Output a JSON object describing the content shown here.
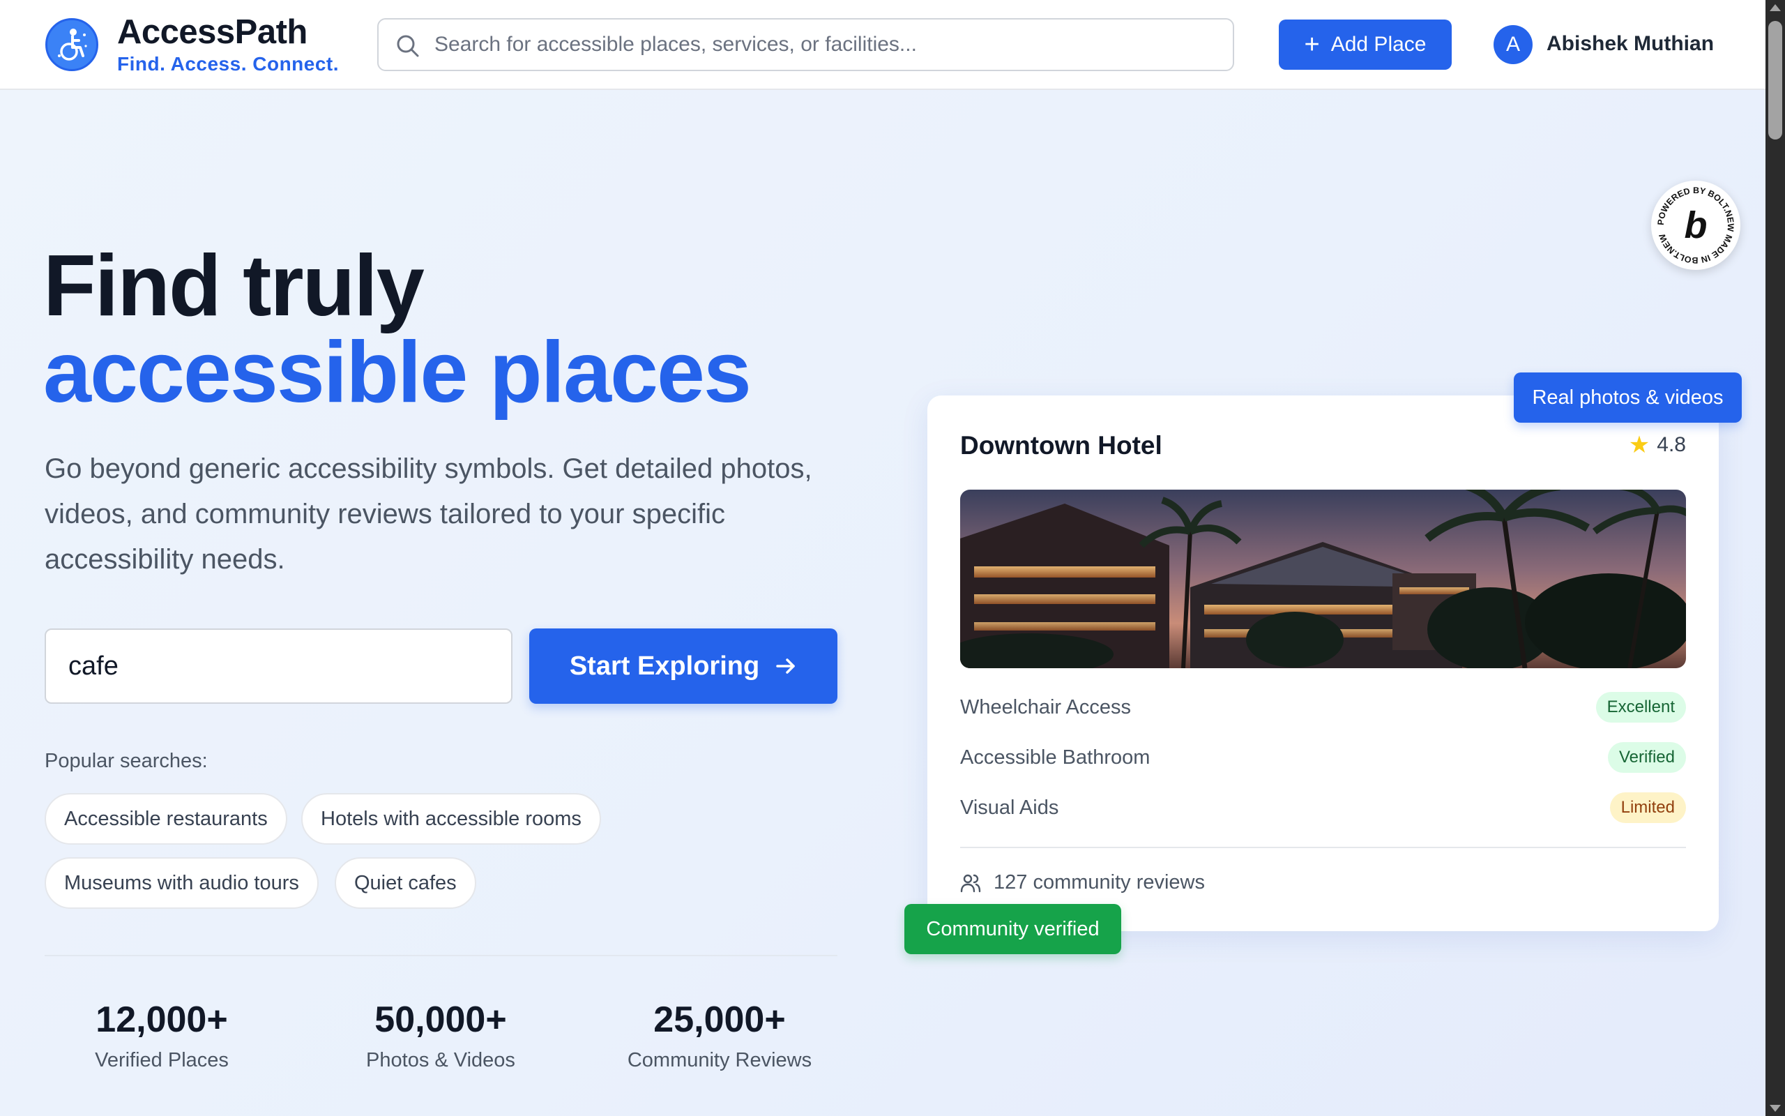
{
  "header": {
    "brand_name": "AccessPath",
    "brand_tagline": "Find. Access. Connect.",
    "search_placeholder": "Search for accessible places, services, or facilities...",
    "add_place_label": "Add Place",
    "user_initial": "A",
    "user_name": "Abishek Muthian"
  },
  "hero": {
    "title_line1": "Find truly",
    "title_line2": "accessible places",
    "description": "Go beyond generic accessibility symbols. Get detailed photos, videos, and community reviews tailored to your specific accessibility needs.",
    "search_value": "cafe",
    "explore_label": "Start Exploring",
    "popular_label": "Popular searches:",
    "popular_searches": [
      "Accessible restaurants",
      "Hotels with accessible rooms",
      "Museums with audio tours",
      "Quiet cafes"
    ]
  },
  "stats": [
    {
      "value": "12,000+",
      "label": "Verified Places"
    },
    {
      "value": "50,000+",
      "label": "Photos & Videos"
    },
    {
      "value": "25,000+",
      "label": "Community Reviews"
    }
  ],
  "card": {
    "title": "Downtown Hotel",
    "rating": "4.8",
    "features": [
      {
        "label": "Wheelchair Access",
        "status": "Excellent",
        "tone": "green"
      },
      {
        "label": "Accessible Bathroom",
        "status": "Verified",
        "tone": "green"
      },
      {
        "label": "Visual Aids",
        "status": "Limited",
        "tone": "yellow"
      }
    ],
    "reviews_text": "127 community reviews",
    "tag_photos": "Real photos & videos",
    "tag_verified": "Community verified"
  },
  "bolt_badge": {
    "ring_text": "POWERED BY BOLT.NEW MADE IN BOLT.NEW ",
    "letter": "b"
  },
  "colors": {
    "accent": "#2563eb",
    "success": "#16a34a",
    "star": "#facc15"
  },
  "icons": [
    "wheelchair-logo-icon",
    "search-icon",
    "plus-icon",
    "arrow-right-icon",
    "star-icon",
    "users-icon",
    "bolt-logo-icon"
  ]
}
